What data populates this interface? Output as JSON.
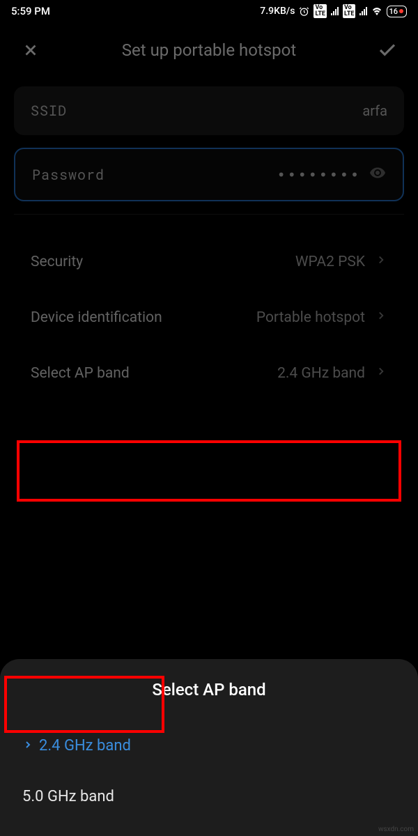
{
  "status": {
    "time": "5:59 PM",
    "data_rate": "7.9KB/s",
    "lte_badge": "VoLTE",
    "battery": "16"
  },
  "header": {
    "title": "Set up portable hotspot"
  },
  "fields": {
    "ssid_label": "SSID",
    "ssid_value": "arfa",
    "password_label": "Password",
    "password_value": "••••••••"
  },
  "settings": {
    "security_label": "Security",
    "security_value": "WPA2 PSK",
    "device_id_label": "Device identification",
    "device_id_value": "Portable hotspot",
    "ap_band_label": "Select AP band",
    "ap_band_value": "2.4 GHz band"
  },
  "sheet": {
    "title": "Select AP band",
    "option1": "2.4 GHz band",
    "option2": "5.0 GHz band"
  },
  "watermark": "wsxdn.com"
}
